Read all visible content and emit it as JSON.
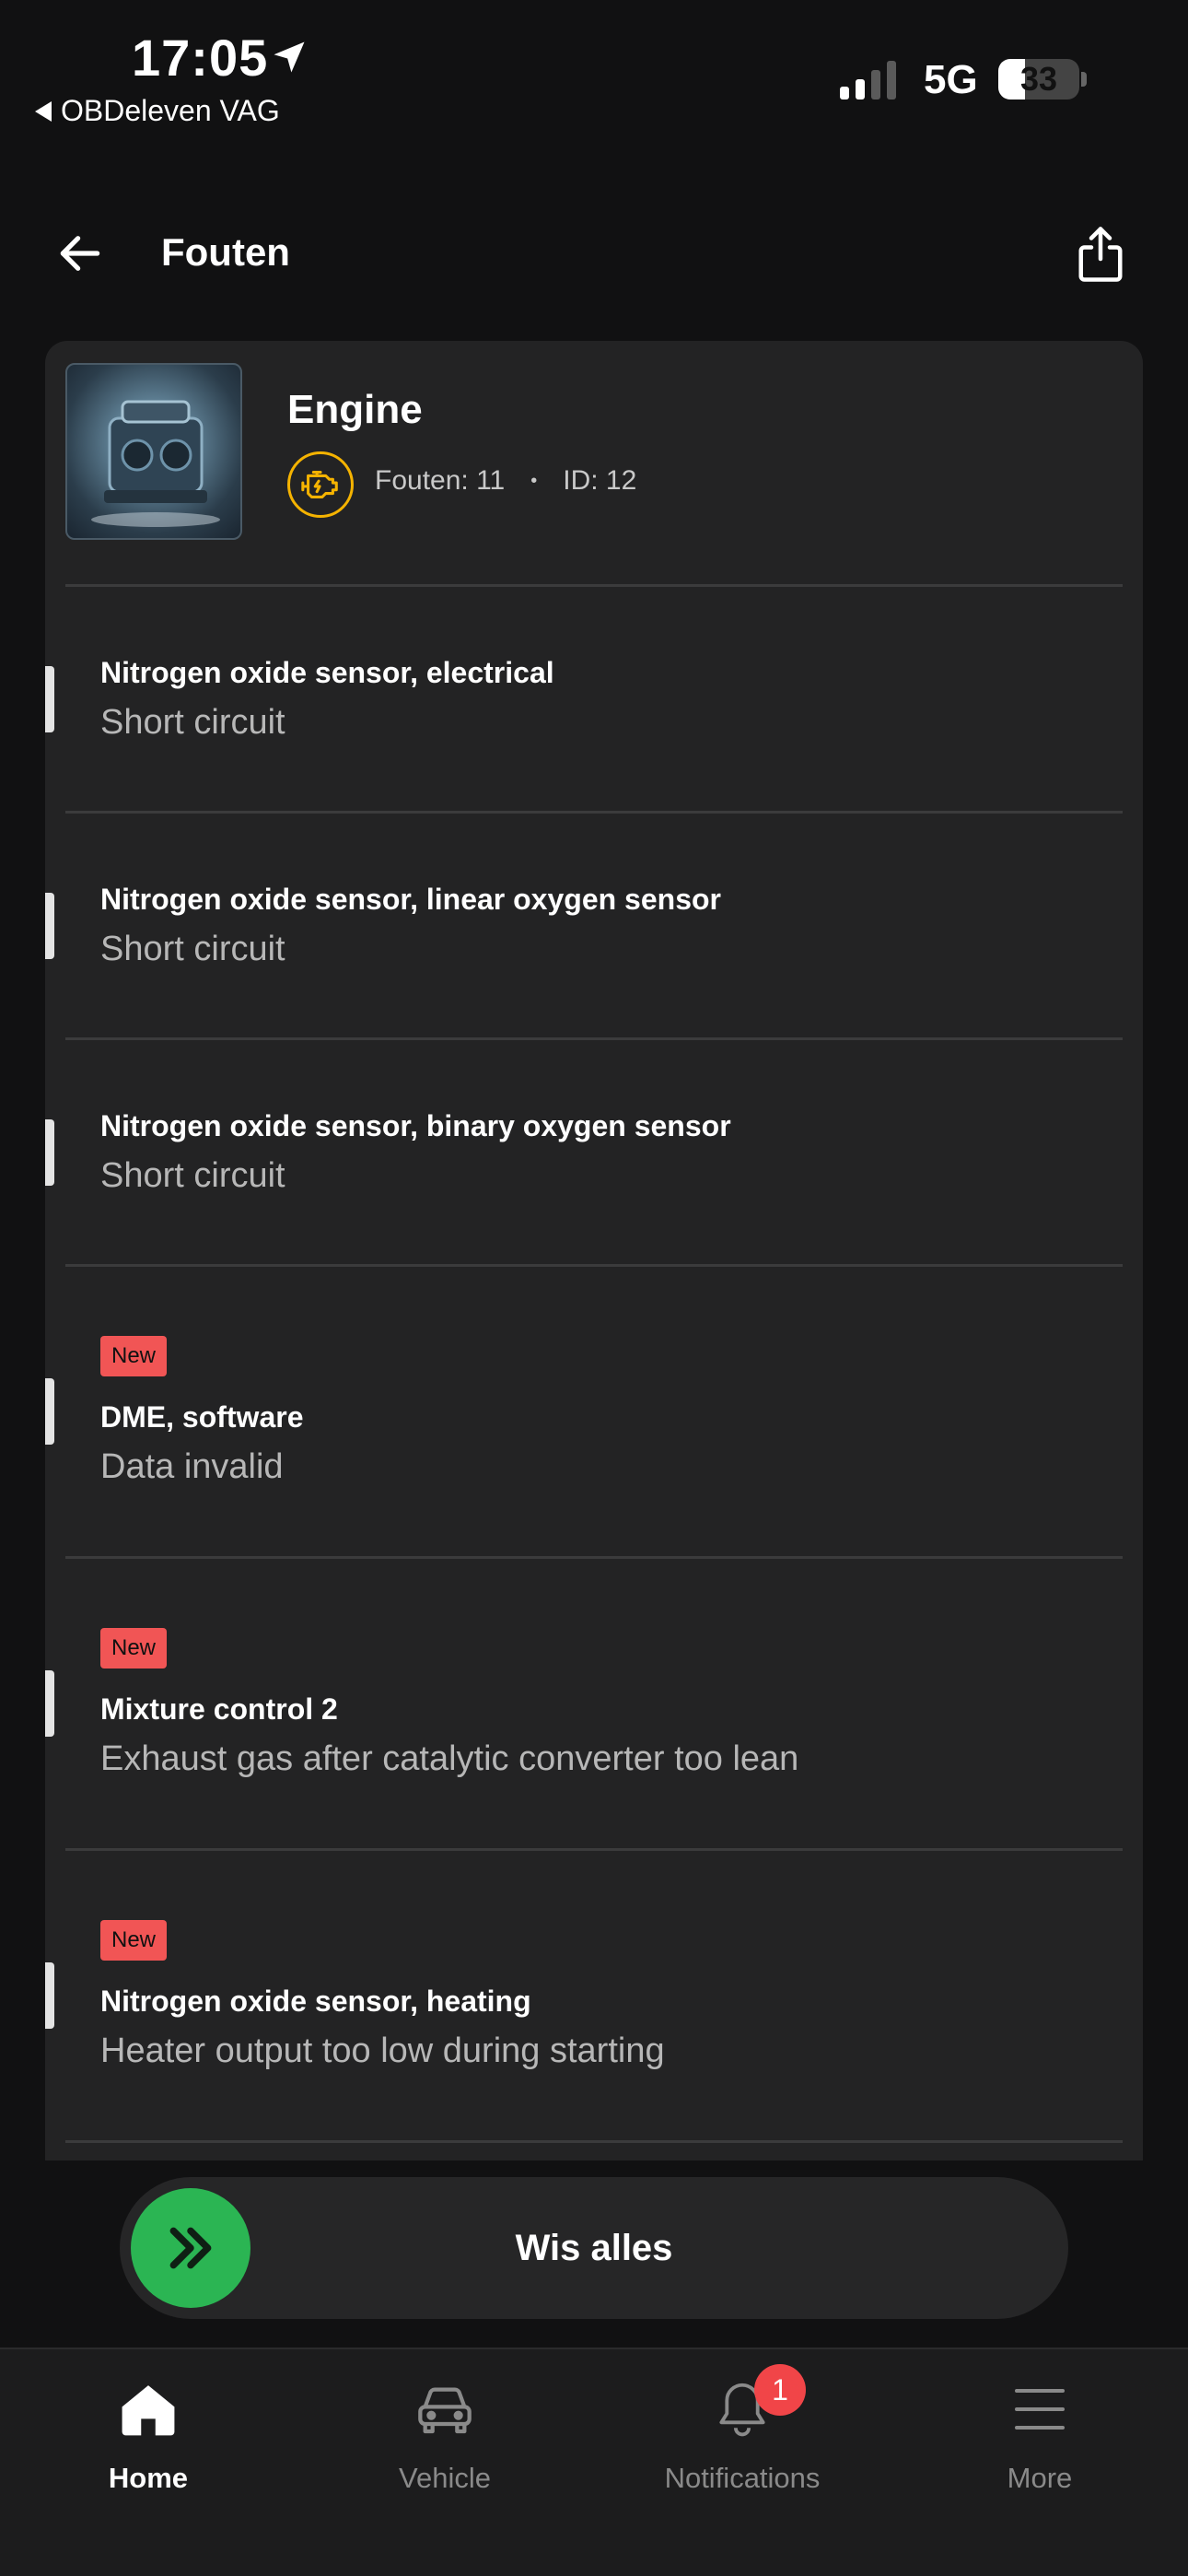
{
  "status_bar": {
    "time": "17:05",
    "back_app": "OBDeleven VAG",
    "network": "5G",
    "battery": "33"
  },
  "header": {
    "title": "Fouten"
  },
  "module": {
    "name": "Engine",
    "faults_label": "Fouten: 11",
    "separator": "•",
    "id_label": "ID: 12"
  },
  "faults": [
    {
      "title": "Nitrogen oxide sensor, electrical",
      "description": "Short circuit",
      "badge": ""
    },
    {
      "title": "Nitrogen oxide sensor, linear oxygen sensor",
      "description": "Short circuit",
      "badge": ""
    },
    {
      "title": "Nitrogen oxide sensor, binary oxygen sensor",
      "description": "Short circuit",
      "badge": ""
    },
    {
      "title": "DME, software",
      "description": "Data invalid",
      "badge": "New"
    },
    {
      "title": "Mixture control 2",
      "description": "Exhaust gas after catalytic converter too lean",
      "badge": "New"
    },
    {
      "title": "Nitrogen oxide sensor, heating",
      "description": "Heater output too low during starting",
      "badge": "New"
    }
  ],
  "swipe_button": {
    "label": "Wis alles"
  },
  "tab_bar": {
    "tabs": [
      {
        "label": "Home",
        "icon": "home-icon"
      },
      {
        "label": "Vehicle",
        "icon": "car-icon"
      },
      {
        "label": "Notifications",
        "icon": "bell-icon",
        "badge": "1"
      },
      {
        "label": "More",
        "icon": "menu-icon"
      }
    ]
  },
  "colors": {
    "accent_green": "#2bb553",
    "new_badge": "#f15555",
    "ecu_icon": "#f5b301",
    "notification_badge": "#f14548"
  }
}
